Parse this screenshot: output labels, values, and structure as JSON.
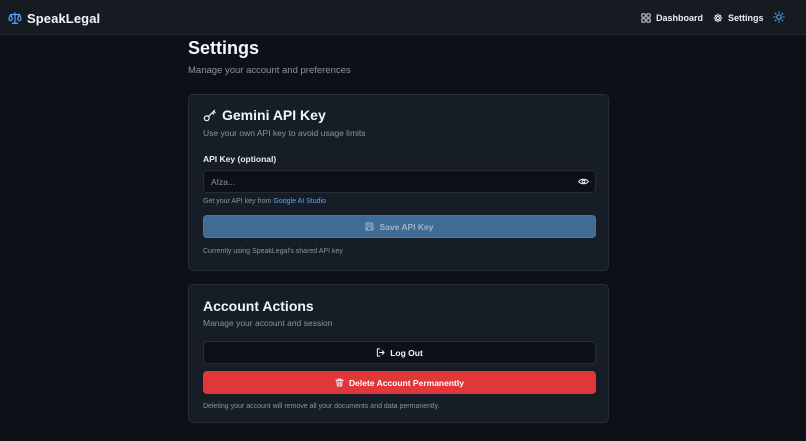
{
  "header": {
    "brand": "SpeakLegal",
    "brand_icon": "scale-icon",
    "nav": {
      "dashboard_label": "Dashboard",
      "settings_label": "Settings"
    },
    "theme_toggle_icon": "sun-icon"
  },
  "page": {
    "title": "Settings",
    "subtitle": "Manage your account and preferences"
  },
  "api_card": {
    "title": "Gemini API Key",
    "title_icon": "key-icon",
    "description": "Use your own API key to avoid usage limits",
    "field_label": "API Key (optional)",
    "input_value": "",
    "input_placeholder": "AIza...",
    "hint_prefix": "Get your API key from ",
    "hint_link": "Google AI Studio",
    "save_label": "Save API Key",
    "status": "Currently using SpeakLegal's shared API key"
  },
  "account_card": {
    "title": "Account Actions",
    "description": "Manage your account and session",
    "logout_label": "Log Out",
    "delete_label": "Delete Account Permanently",
    "warning": "Deleting your account will remove all your documents and data permanently."
  },
  "colors": {
    "background": "#0d1117",
    "card": "#161d27",
    "accent": "#3f6b95",
    "danger": "#e0383a",
    "link": "#58a6ff"
  }
}
